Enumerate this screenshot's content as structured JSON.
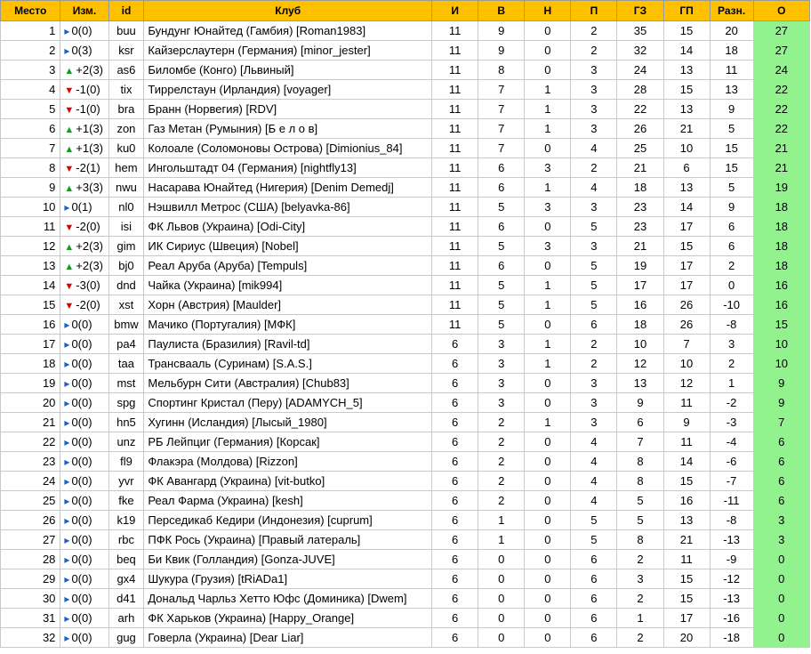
{
  "headers": [
    "Место",
    "Изм.",
    "id",
    "Клуб",
    "И",
    "В",
    "Н",
    "П",
    "ГЗ",
    "ГП",
    "Разн.",
    "О"
  ],
  "colors": {
    "header_bg": "#ffc000",
    "points_bg": "#92f38e",
    "up": "#1a9a1a",
    "down": "#e00000",
    "same": "#1f5fd0"
  },
  "rows": [
    {
      "place": "1",
      "dir": "same",
      "change": "0(0)",
      "id": "buu",
      "club": "Бундунг Юнайтед (Гамбия) [Roman1983]",
      "g": "11",
      "w": "9",
      "d": "0",
      "l": "2",
      "gf": "35",
      "ga": "15",
      "diff": "20",
      "pts": "27"
    },
    {
      "place": "2",
      "dir": "same",
      "change": "0(3)",
      "id": "ksr",
      "club": "Кайзерслаутерн (Германия) [minor_jester]",
      "g": "11",
      "w": "9",
      "d": "0",
      "l": "2",
      "gf": "32",
      "ga": "14",
      "diff": "18",
      "pts": "27"
    },
    {
      "place": "3",
      "dir": "up",
      "change": "+2(3)",
      "id": "as6",
      "club": "Биломбе (Конго) [Львиный]",
      "g": "11",
      "w": "8",
      "d": "0",
      "l": "3",
      "gf": "24",
      "ga": "13",
      "diff": "11",
      "pts": "24"
    },
    {
      "place": "4",
      "dir": "down",
      "change": "-1(0)",
      "id": "tix",
      "club": "Тиррелстаун (Ирландия) [voyager]",
      "g": "11",
      "w": "7",
      "d": "1",
      "l": "3",
      "gf": "28",
      "ga": "15",
      "diff": "13",
      "pts": "22"
    },
    {
      "place": "5",
      "dir": "down",
      "change": "-1(0)",
      "id": "bra",
      "club": "Бранн (Норвегия) [RDV]",
      "g": "11",
      "w": "7",
      "d": "1",
      "l": "3",
      "gf": "22",
      "ga": "13",
      "diff": "9",
      "pts": "22"
    },
    {
      "place": "6",
      "dir": "up",
      "change": "+1(3)",
      "id": "zon",
      "club": "Газ Метан (Румыния) [Б е л о в]",
      "g": "11",
      "w": "7",
      "d": "1",
      "l": "3",
      "gf": "26",
      "ga": "21",
      "diff": "5",
      "pts": "22"
    },
    {
      "place": "7",
      "dir": "up",
      "change": "+1(3)",
      "id": "ku0",
      "club": "Колоале (Соломоновы Острова) [Dimionius_84]",
      "g": "11",
      "w": "7",
      "d": "0",
      "l": "4",
      "gf": "25",
      "ga": "10",
      "diff": "15",
      "pts": "21"
    },
    {
      "place": "8",
      "dir": "down",
      "change": "-2(1)",
      "id": "hem",
      "club": "Ингольштадт 04 (Германия) [nightfly13]",
      "g": "11",
      "w": "6",
      "d": "3",
      "l": "2",
      "gf": "21",
      "ga": "6",
      "diff": "15",
      "pts": "21"
    },
    {
      "place": "9",
      "dir": "up",
      "change": "+3(3)",
      "id": "nwu",
      "club": "Насарава Юнайтед (Нигерия) [Denim Demedj]",
      "g": "11",
      "w": "6",
      "d": "1",
      "l": "4",
      "gf": "18",
      "ga": "13",
      "diff": "5",
      "pts": "19"
    },
    {
      "place": "10",
      "dir": "same",
      "change": "0(1)",
      "id": "nl0",
      "club": "Нэшвилл Метрос (США) [belyavka-86]",
      "g": "11",
      "w": "5",
      "d": "3",
      "l": "3",
      "gf": "23",
      "ga": "14",
      "diff": "9",
      "pts": "18"
    },
    {
      "place": "11",
      "dir": "down",
      "change": "-2(0)",
      "id": "isi",
      "club": "ФК Львов (Украина) [Odi-City]",
      "g": "11",
      "w": "6",
      "d": "0",
      "l": "5",
      "gf": "23",
      "ga": "17",
      "diff": "6",
      "pts": "18"
    },
    {
      "place": "12",
      "dir": "up",
      "change": "+2(3)",
      "id": "gim",
      "club": "ИК Сириус (Швеция) [Nobel]",
      "g": "11",
      "w": "5",
      "d": "3",
      "l": "3",
      "gf": "21",
      "ga": "15",
      "diff": "6",
      "pts": "18"
    },
    {
      "place": "13",
      "dir": "up",
      "change": "+2(3)",
      "id": "bj0",
      "club": "Реал Аруба (Аруба) [Tempuls]",
      "g": "11",
      "w": "6",
      "d": "0",
      "l": "5",
      "gf": "19",
      "ga": "17",
      "diff": "2",
      "pts": "18"
    },
    {
      "place": "14",
      "dir": "down",
      "change": "-3(0)",
      "id": "dnd",
      "club": "Чайка (Украина) [mik994]",
      "g": "11",
      "w": "5",
      "d": "1",
      "l": "5",
      "gf": "17",
      "ga": "17",
      "diff": "0",
      "pts": "16"
    },
    {
      "place": "15",
      "dir": "down",
      "change": "-2(0)",
      "id": "xst",
      "club": "Хорн (Австрия) [Maulder]",
      "g": "11",
      "w": "5",
      "d": "1",
      "l": "5",
      "gf": "16",
      "ga": "26",
      "diff": "-10",
      "pts": "16"
    },
    {
      "place": "16",
      "dir": "same",
      "change": "0(0)",
      "id": "bmw",
      "club": "Мачико (Португалия) [МФК]",
      "g": "11",
      "w": "5",
      "d": "0",
      "l": "6",
      "gf": "18",
      "ga": "26",
      "diff": "-8",
      "pts": "15"
    },
    {
      "place": "17",
      "dir": "same",
      "change": "0(0)",
      "id": "pa4",
      "club": "Паулиста (Бразилия) [Ravil-td]",
      "g": "6",
      "w": "3",
      "d": "1",
      "l": "2",
      "gf": "10",
      "ga": "7",
      "diff": "3",
      "pts": "10"
    },
    {
      "place": "18",
      "dir": "same",
      "change": "0(0)",
      "id": "taa",
      "club": "Трансвааль (Суринам) [S.A.S.]",
      "g": "6",
      "w": "3",
      "d": "1",
      "l": "2",
      "gf": "12",
      "ga": "10",
      "diff": "2",
      "pts": "10"
    },
    {
      "place": "19",
      "dir": "same",
      "change": "0(0)",
      "id": "mst",
      "club": "Мельбурн Сити (Австралия) [Chub83]",
      "g": "6",
      "w": "3",
      "d": "0",
      "l": "3",
      "gf": "13",
      "ga": "12",
      "diff": "1",
      "pts": "9"
    },
    {
      "place": "20",
      "dir": "same",
      "change": "0(0)",
      "id": "spg",
      "club": "Спортинг Кристал (Перу) [ADAMYCH_5]",
      "g": "6",
      "w": "3",
      "d": "0",
      "l": "3",
      "gf": "9",
      "ga": "11",
      "diff": "-2",
      "pts": "9"
    },
    {
      "place": "21",
      "dir": "same",
      "change": "0(0)",
      "id": "hn5",
      "club": "Хугинн (Исландия) [Лысый_1980]",
      "g": "6",
      "w": "2",
      "d": "1",
      "l": "3",
      "gf": "6",
      "ga": "9",
      "diff": "-3",
      "pts": "7"
    },
    {
      "place": "22",
      "dir": "same",
      "change": "0(0)",
      "id": "unz",
      "club": "РБ Лейпциг (Германия) [Корсак]",
      "g": "6",
      "w": "2",
      "d": "0",
      "l": "4",
      "gf": "7",
      "ga": "11",
      "diff": "-4",
      "pts": "6"
    },
    {
      "place": "23",
      "dir": "same",
      "change": "0(0)",
      "id": "fl9",
      "club": "Флакэра (Молдова) [Rizzon]",
      "g": "6",
      "w": "2",
      "d": "0",
      "l": "4",
      "gf": "8",
      "ga": "14",
      "diff": "-6",
      "pts": "6"
    },
    {
      "place": "24",
      "dir": "same",
      "change": "0(0)",
      "id": "yvr",
      "club": "ФК Авангард (Украина) [vit-butko]",
      "g": "6",
      "w": "2",
      "d": "0",
      "l": "4",
      "gf": "8",
      "ga": "15",
      "diff": "-7",
      "pts": "6"
    },
    {
      "place": "25",
      "dir": "same",
      "change": "0(0)",
      "id": "fke",
      "club": "Реал Фарма (Украина) [kesh]",
      "g": "6",
      "w": "2",
      "d": "0",
      "l": "4",
      "gf": "5",
      "ga": "16",
      "diff": "-11",
      "pts": "6"
    },
    {
      "place": "26",
      "dir": "same",
      "change": "0(0)",
      "id": "k19",
      "club": "Перседикаб Кедири (Индонезия) [cuprum]",
      "g": "6",
      "w": "1",
      "d": "0",
      "l": "5",
      "gf": "5",
      "ga": "13",
      "diff": "-8",
      "pts": "3"
    },
    {
      "place": "27",
      "dir": "same",
      "change": "0(0)",
      "id": "rbc",
      "club": "ПФК Рось (Украина) [Правый латераль]",
      "g": "6",
      "w": "1",
      "d": "0",
      "l": "5",
      "gf": "8",
      "ga": "21",
      "diff": "-13",
      "pts": "3"
    },
    {
      "place": "28",
      "dir": "same",
      "change": "0(0)",
      "id": "beq",
      "club": "Би Квик (Голландия) [Gonza-JUVE]",
      "g": "6",
      "w": "0",
      "d": "0",
      "l": "6",
      "gf": "2",
      "ga": "11",
      "diff": "-9",
      "pts": "0"
    },
    {
      "place": "29",
      "dir": "same",
      "change": "0(0)",
      "id": "gx4",
      "club": "Шукура (Грузия) [tRiADa1]",
      "g": "6",
      "w": "0",
      "d": "0",
      "l": "6",
      "gf": "3",
      "ga": "15",
      "diff": "-12",
      "pts": "0"
    },
    {
      "place": "30",
      "dir": "same",
      "change": "0(0)",
      "id": "d41",
      "club": "Дональд Чарльз Хетто Юфс (Доминика) [Dwem]",
      "g": "6",
      "w": "0",
      "d": "0",
      "l": "6",
      "gf": "2",
      "ga": "15",
      "diff": "-13",
      "pts": "0"
    },
    {
      "place": "31",
      "dir": "same",
      "change": "0(0)",
      "id": "arh",
      "club": "ФК Харьков (Украина) [Happy_Orange]",
      "g": "6",
      "w": "0",
      "d": "0",
      "l": "6",
      "gf": "1",
      "ga": "17",
      "diff": "-16",
      "pts": "0"
    },
    {
      "place": "32",
      "dir": "same",
      "change": "0(0)",
      "id": "gug",
      "club": "Говерла (Украина) [Dear Liar]",
      "g": "6",
      "w": "0",
      "d": "0",
      "l": "6",
      "gf": "2",
      "ga": "20",
      "diff": "-18",
      "pts": "0"
    }
  ]
}
